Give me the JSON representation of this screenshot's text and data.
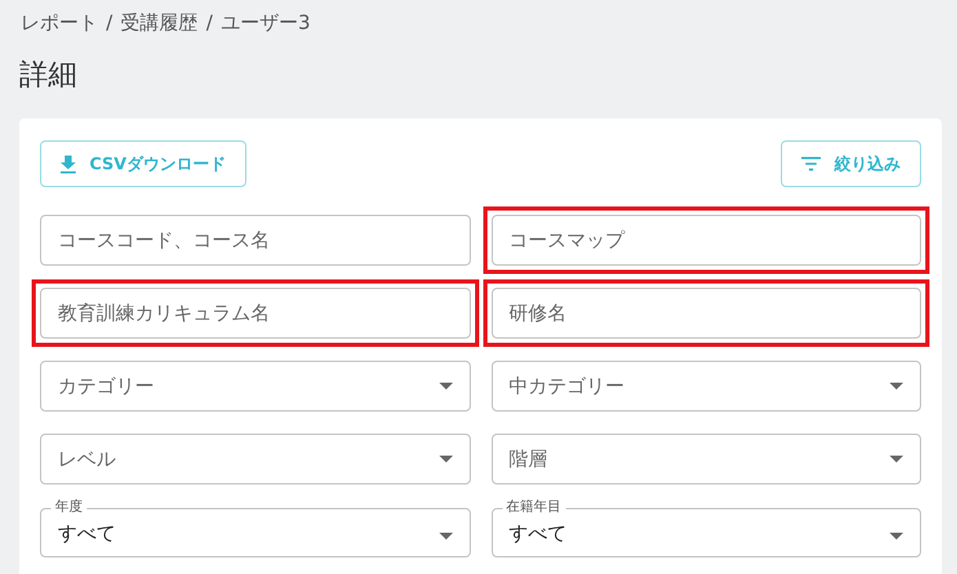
{
  "breadcrumb": {
    "items": [
      "レポート",
      "受講履歴",
      "ユーザー3"
    ],
    "separators": [
      "/",
      "/"
    ]
  },
  "title": "詳細",
  "toolbar": {
    "download_button": "CSVダウンロード",
    "filter_button": "絞り込み"
  },
  "fields": [
    {
      "kind": "text",
      "placeholder": "コースコード、コース名",
      "highlighted": false
    },
    {
      "kind": "text",
      "placeholder": "コースマップ",
      "highlighted": true
    },
    {
      "kind": "text",
      "placeholder": "教育訓練カリキュラム名",
      "highlighted": true
    },
    {
      "kind": "text",
      "placeholder": "研修名",
      "highlighted": true
    },
    {
      "kind": "select",
      "placeholder": "カテゴリー",
      "highlighted": false
    },
    {
      "kind": "select",
      "placeholder": "中カテゴリー",
      "highlighted": false
    },
    {
      "kind": "select",
      "placeholder": "レベル",
      "highlighted": false
    },
    {
      "kind": "select",
      "placeholder": "階層",
      "highlighted": false
    },
    {
      "kind": "labeled-select",
      "label": "年度",
      "value": "すべて",
      "highlighted": false
    },
    {
      "kind": "labeled-select",
      "label": "在籍年目",
      "value": "すべて",
      "highlighted": false
    }
  ]
}
